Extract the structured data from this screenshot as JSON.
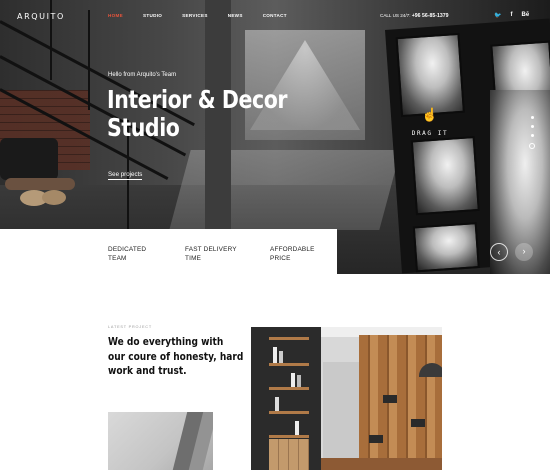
{
  "header": {
    "logo": "ARQUITO",
    "menu": [
      "HOME",
      "STUDIO",
      "SERVICES",
      "NEWS",
      "CONTACT"
    ],
    "active_menu": "HOME",
    "call_label": "CALL US 24/7:",
    "phone": "+96 56-85-1379",
    "social": [
      "twitter-icon",
      "facebook-icon",
      "behance-icon"
    ],
    "social_glyphs": [
      "🐦",
      "f",
      "Bē"
    ]
  },
  "hero": {
    "greeting": "Hello from Arquito's Team",
    "title_line1": "Interior & Decor",
    "title_line2": "Studio",
    "cta": "See projects",
    "drag_label": "DRAG IT",
    "slides": 4,
    "current_slide": 4,
    "prev_arrow": "‹",
    "next_arrow": "›"
  },
  "features": [
    {
      "line1": "DEDICATED",
      "line2": "TEAM"
    },
    {
      "line1": "FAST DELIVERY",
      "line2": "TIME"
    },
    {
      "line1": "AFFORDABLE",
      "line2": "PRICE"
    }
  ],
  "about": {
    "eyebrow": "LATEST PROJECT",
    "line1": "We do everything with",
    "line2": "our coure of honesty, hard",
    "line3": "work and trust."
  },
  "colors": {
    "accent": "#e6543b",
    "hero_text": "#ffffff"
  }
}
